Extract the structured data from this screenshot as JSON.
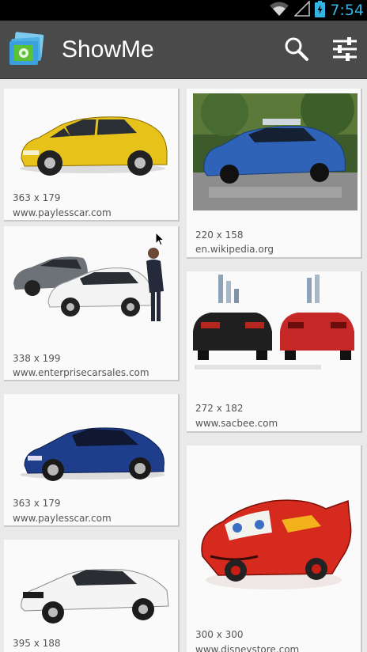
{
  "status_bar": {
    "time": "7:54"
  },
  "action_bar": {
    "title": "ShowMe",
    "search_icon": "search-icon",
    "filter_icon": "sliders-icon"
  },
  "colors": {
    "accent": "#33b5e5",
    "action_bar": "#4a4a4a",
    "card_bg": "#fafafa"
  },
  "results": [
    {
      "column": "left",
      "dimensions": "363 x 179",
      "source": "www.paylesscar.com",
      "subject": "yellow hatchback car"
    },
    {
      "column": "left",
      "dimensions": "338 x 199",
      "source": "www.enterprisecarsales.com",
      "subject": "two cars with woman"
    },
    {
      "column": "left",
      "dimensions": "363 x 179",
      "source": "www.paylesscar.com",
      "subject": "blue sedan"
    },
    {
      "column": "left",
      "dimensions": "395 x 188",
      "source": "",
      "subject": "white muscle car"
    },
    {
      "column": "right",
      "dimensions": "220 x 158",
      "source": "en.wikipedia.org",
      "subject": "blue robotic car"
    },
    {
      "column": "right",
      "dimensions": "272 x 182",
      "source": "www.sacbee.com",
      "subject": "two mustang cars"
    },
    {
      "column": "right",
      "dimensions": "300 x 300",
      "source": "www.disneystore.com",
      "subject": "red cartoon race car"
    }
  ]
}
